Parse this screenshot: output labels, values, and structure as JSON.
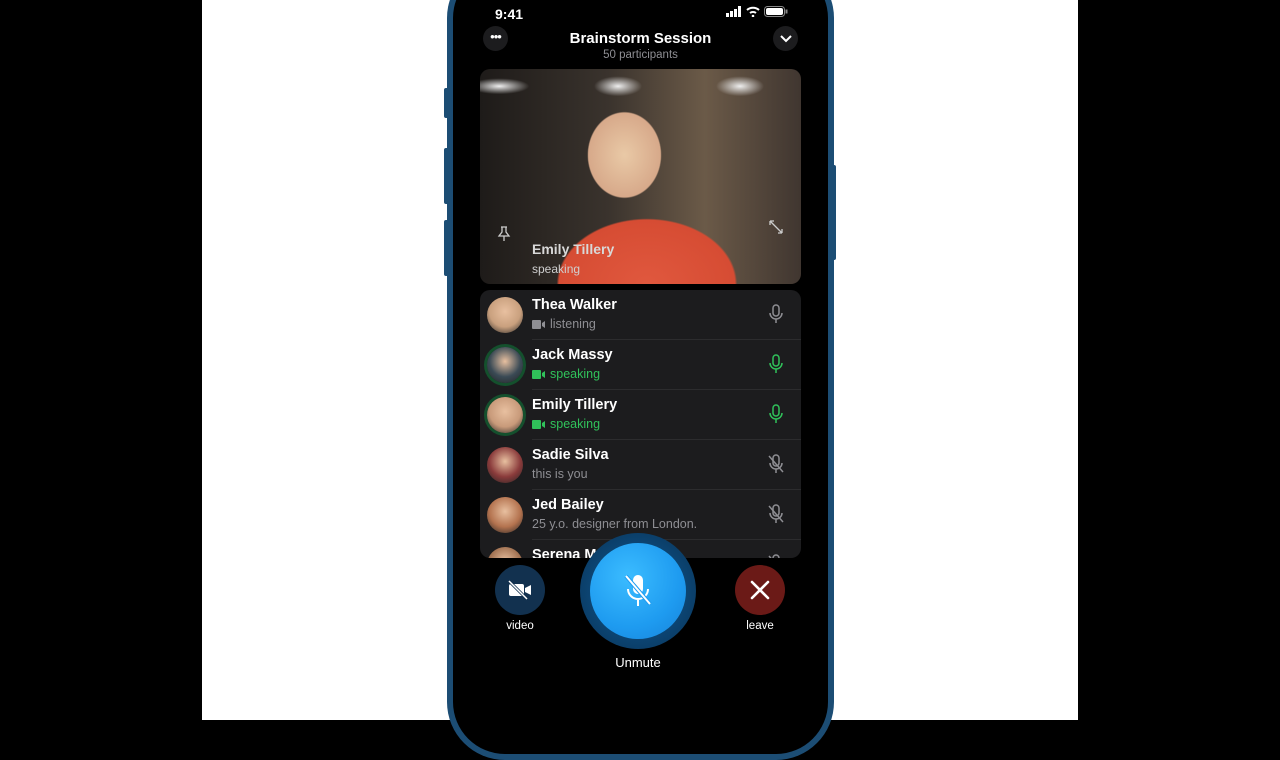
{
  "status_bar": {
    "time": "9:41"
  },
  "header": {
    "title": "Brainstorm Session",
    "subtitle": "50 participants",
    "more_icon": "ellipsis-icon",
    "collapse_icon": "chevron-down-icon"
  },
  "video_tile": {
    "name": "Emily Tillery",
    "status": "speaking"
  },
  "participants": [
    {
      "name": "Thea Walker",
      "status": "listening",
      "state": "listening",
      "avatar": "#c9a07e"
    },
    {
      "name": "Jack Massy",
      "status": "speaking",
      "state": "speaking",
      "avatar": "#3a4a55"
    },
    {
      "name": "Emily Tillery",
      "status": "speaking",
      "state": "speaking",
      "avatar": "#c89a7a"
    },
    {
      "name": "Sadie Silva",
      "status": "this is you",
      "state": "muted",
      "avatar": "#8a3b3b"
    },
    {
      "name": "Jed Bailey",
      "status": "25 y.o. designer from London.",
      "state": "muted",
      "avatar": "#b4734f"
    },
    {
      "name": "Serena Moreno",
      "status": "",
      "state": "muted",
      "avatar": "#a07050"
    }
  ],
  "controls": {
    "video_label": "video",
    "unmute_label": "Unmute",
    "leave_label": "leave"
  },
  "colors": {
    "speaking": "#30c25a",
    "unmute": "#1e9bf0",
    "leave": "#6b1a17",
    "video_btn": "#12314f",
    "frame": "#1c4d74"
  }
}
